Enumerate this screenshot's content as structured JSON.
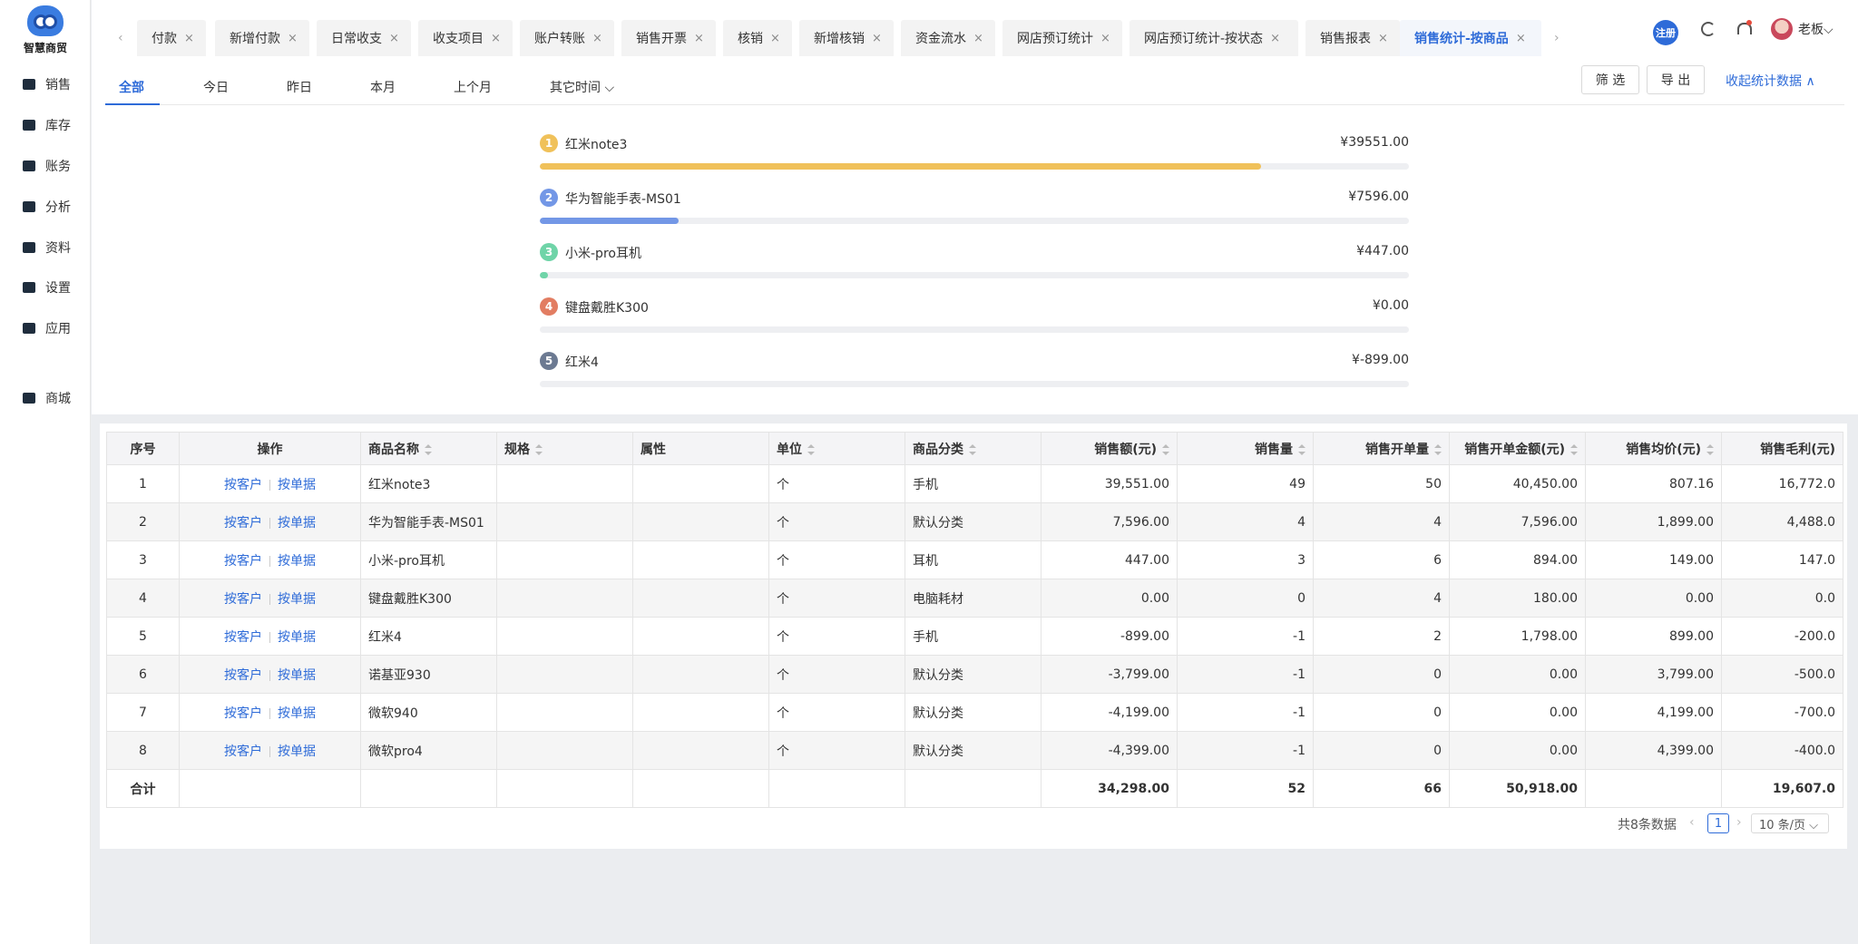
{
  "app": {
    "name": "智慧商贸"
  },
  "sidebar": {
    "items": [
      {
        "label": "销售",
        "icon": "store-icon"
      },
      {
        "label": "库存",
        "icon": "inventory-icon"
      },
      {
        "label": "账务",
        "icon": "wallet-icon"
      },
      {
        "label": "分析",
        "icon": "chart-icon"
      },
      {
        "label": "资料",
        "icon": "box-icon"
      },
      {
        "label": "设置",
        "icon": "gear-icon"
      },
      {
        "label": "应用",
        "icon": "apps-icon"
      },
      {
        "label": "商城",
        "icon": "shop-bag-icon"
      }
    ]
  },
  "tabs": {
    "items": [
      "付款",
      "新增付款",
      "日常收支",
      "收支项目",
      "账户转账",
      "销售开票",
      "核销",
      "新增核销",
      "资金流水",
      "网店预订统计",
      "网店预订统计-按状态",
      "销售报表",
      "销售统计-按商品"
    ],
    "active_index": 12,
    "close_glyph": "×",
    "prev_glyph": "‹",
    "next_glyph": "›"
  },
  "header": {
    "register_label": "注册",
    "user_name": "老板",
    "user_caret": "⌵"
  },
  "period": {
    "tabs": [
      "全部",
      "今日",
      "昨日",
      "本月",
      "上个月",
      "其它时间 ⌵"
    ],
    "active_index": 0
  },
  "actions": {
    "filter_label": "筛 选",
    "export_label": "导 出",
    "collapse_label": "收起统计数据 ∧"
  },
  "ranking": {
    "items": [
      {
        "rank": "1",
        "name": "红米note3",
        "amount": "¥39551.00",
        "share": 0.83,
        "color": "#f0c15a",
        "badge_color": "#f0c15a"
      },
      {
        "rank": "2",
        "name": "华为智能手表-MS01",
        "amount": "¥7596.00",
        "share": 0.16,
        "color": "#7397e6",
        "badge_color": "#7397e6"
      },
      {
        "rank": "3",
        "name": "小米-pro耳机",
        "amount": "¥447.00",
        "share": 0.009,
        "color": "#6fd4a8",
        "badge_color": "#6fd4a8"
      },
      {
        "rank": "4",
        "name": "键盘戴胜K300",
        "amount": "¥0.00",
        "share": 0,
        "color": "#e27d62",
        "badge_color": "#e27d62"
      },
      {
        "rank": "5",
        "name": "红米4",
        "amount": "¥-899.00",
        "share": 0,
        "color": "#6c7a92",
        "badge_color": "#6c7a92"
      }
    ]
  },
  "table": {
    "headers": [
      "序号",
      "操作",
      "商品名称",
      "规格",
      "属性",
      "单位",
      "商品分类",
      "销售额(元)",
      "销售量",
      "销售开单量",
      "销售开单金额(元)",
      "销售均价(元)",
      "销售毛利(元)"
    ],
    "op_customer": "按客户",
    "op_document": "按单据",
    "rows": [
      {
        "no": "1",
        "name": "红米note3",
        "spec": "",
        "attr": "",
        "unit": "个",
        "category": "手机",
        "sales": "39,551.00",
        "qty": "49",
        "orders": "50",
        "order_amount": "40,450.00",
        "avg_price": "807.16",
        "profit": "16,772.0"
      },
      {
        "no": "2",
        "name": "华为智能手表-MS01",
        "spec": "",
        "attr": "",
        "unit": "个",
        "category": "默认分类",
        "sales": "7,596.00",
        "qty": "4",
        "orders": "4",
        "order_amount": "7,596.00",
        "avg_price": "1,899.00",
        "profit": "4,488.0"
      },
      {
        "no": "3",
        "name": "小米-pro耳机",
        "spec": "",
        "attr": "",
        "unit": "个",
        "category": "耳机",
        "sales": "447.00",
        "qty": "3",
        "orders": "6",
        "order_amount": "894.00",
        "avg_price": "149.00",
        "profit": "147.0"
      },
      {
        "no": "4",
        "name": "键盘戴胜K300",
        "spec": "",
        "attr": "",
        "unit": "个",
        "category": "电脑耗材",
        "sales": "0.00",
        "qty": "0",
        "orders": "4",
        "order_amount": "180.00",
        "avg_price": "0.00",
        "profit": "0.0"
      },
      {
        "no": "5",
        "name": "红米4",
        "spec": "",
        "attr": "",
        "unit": "个",
        "category": "手机",
        "sales": "-899.00",
        "qty": "-1",
        "orders": "2",
        "order_amount": "1,798.00",
        "avg_price": "899.00",
        "profit": "-200.0"
      },
      {
        "no": "6",
        "name": "诺基亚930",
        "spec": "",
        "attr": "",
        "unit": "个",
        "category": "默认分类",
        "sales": "-3,799.00",
        "qty": "-1",
        "orders": "0",
        "order_amount": "0.00",
        "avg_price": "3,799.00",
        "profit": "-500.0"
      },
      {
        "no": "7",
        "name": "微软940",
        "spec": "",
        "attr": "",
        "unit": "个",
        "category": "默认分类",
        "sales": "-4,199.00",
        "qty": "-1",
        "orders": "0",
        "order_amount": "0.00",
        "avg_price": "4,199.00",
        "profit": "-700.0"
      },
      {
        "no": "8",
        "name": "微软pro4",
        "spec": "",
        "attr": "",
        "unit": "个",
        "category": "默认分类",
        "sales": "-4,399.00",
        "qty": "-1",
        "orders": "0",
        "order_amount": "0.00",
        "avg_price": "4,399.00",
        "profit": "-400.0"
      }
    ],
    "total": {
      "label": "合计",
      "sales": "34,298.00",
      "qty": "52",
      "orders": "66",
      "order_amount": "50,918.00",
      "profit": "19,607.0"
    }
  },
  "pagination": {
    "total_text": "共8条数据",
    "current_page": "1",
    "page_size": "10 条/页 ⌵",
    "prev_glyph": "‹",
    "next_glyph": "›"
  }
}
